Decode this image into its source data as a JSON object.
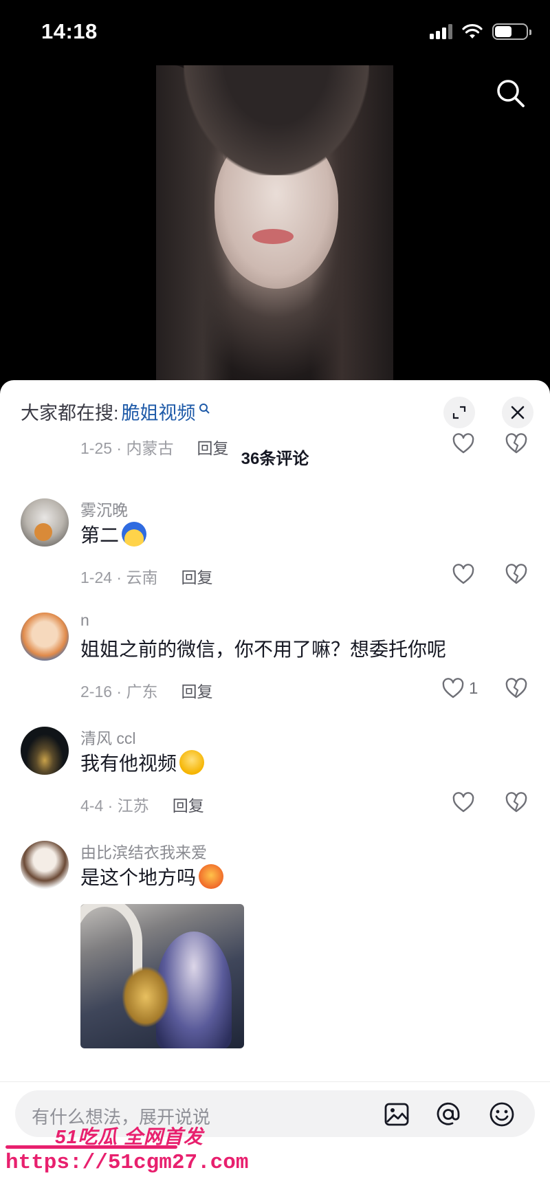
{
  "status_bar": {
    "time": "14:18"
  },
  "sheet": {
    "hot_search_label": "大家都在搜:",
    "hot_search_term": "脆姐视频",
    "comment_count": "36条评论"
  },
  "top_partial": {
    "meta": "1-25 · 内蒙古",
    "reply": "回复"
  },
  "comments": [
    {
      "username": "雾沉晚",
      "text": "第二",
      "meta": "1-24 · 云南",
      "reply": "回复",
      "likes": ""
    },
    {
      "username": "n",
      "text": "姐姐之前的微信，你不用了嘛？想委托你呢",
      "meta": "2-16 · 广东",
      "reply": "回复",
      "likes": "1"
    },
    {
      "username": "清风 ccl",
      "text": "我有他视频",
      "meta": "4-4 · 江苏",
      "reply": "回复",
      "likes": ""
    },
    {
      "username": "由比滨结衣我来爱",
      "text": "是这个地方吗",
      "meta": "",
      "reply": "",
      "likes": ""
    }
  ],
  "input": {
    "placeholder": "有什么想法，展开说说"
  },
  "watermark": {
    "line1": "51吃瓜 全网首发",
    "line2": "https://51cgm27.com"
  },
  "colors": {
    "link_blue": "#1e5aa8",
    "watermark_pink": "#e8206e"
  },
  "icons": [
    "search-icon",
    "expand-icon",
    "close-icon",
    "heart-icon",
    "broken-heart-icon",
    "image-icon",
    "at-icon",
    "emoji-icon"
  ]
}
